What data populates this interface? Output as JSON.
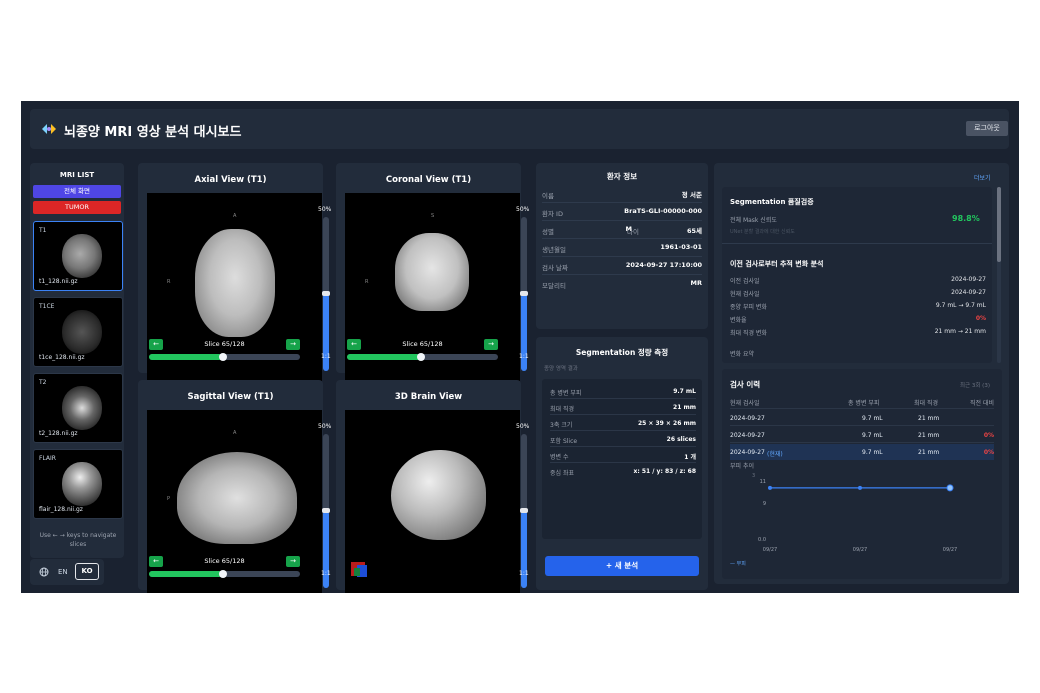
{
  "header": {
    "title": "뇌종양 MRI 영상 분석 대시보드",
    "logout": "로그아웃"
  },
  "sidebar": {
    "title": "MRI LIST",
    "full_view": "전체 화면",
    "tumor": "TUMOR",
    "items": [
      {
        "tag": "T1",
        "file": "t1_128.nii.gz"
      },
      {
        "tag": "T1CE",
        "file": "t1ce_128.nii.gz"
      },
      {
        "tag": "T2",
        "file": "t2_128.nii.gz"
      },
      {
        "tag": "FLAIR",
        "file": "flair_128.nii.gz"
      }
    ],
    "hint": "Use ← → keys to navigate slices"
  },
  "lang": {
    "en": "EN",
    "ko": "KO"
  },
  "views": {
    "axial": {
      "title": "Axial View (T1)",
      "slice": "Slice 65/128",
      "pct": "50%",
      "scale": "1:1"
    },
    "coronal": {
      "title": "Coronal View (T1)",
      "slice": "Slice 65/128",
      "pct": "50%",
      "scale": "1:1"
    },
    "sagittal": {
      "title": "Sagittal View (T1)",
      "slice": "Slice 65/128",
      "pct": "50%",
      "scale": "1:1"
    },
    "brain3d": {
      "title": "3D Brain View",
      "pct": "50%",
      "scale": "1:1"
    },
    "zoom_fraction": 0.5,
    "slice_fraction": 0.508
  },
  "patient": {
    "title": "환자 정보",
    "rows": [
      {
        "k": "이름",
        "v": "정 서준"
      },
      {
        "k": "환자 ID",
        "v": "BraTS-GLI-00000-000"
      },
      {
        "k": "성별",
        "v": "M"
      },
      {
        "k": "생년월일",
        "v": "1961-03-01"
      },
      {
        "k": "검사 날짜",
        "v": "2024-09-27 17:10:00"
      },
      {
        "k": "모달리티",
        "v": "MR"
      }
    ],
    "age_label": "나이",
    "age": "65세"
  },
  "measure": {
    "title": "Segmentation 정량 측정",
    "subtitle": "종양 영역 결과",
    "rows": [
      {
        "k": "총 병변 부피",
        "v": "9.7 mL"
      },
      {
        "k": "최대 직경",
        "v": "21 mm"
      },
      {
        "k": "3축 크기",
        "v": "25 × 39 × 26 mm"
      },
      {
        "k": "포함 Slice",
        "v": "26 slices"
      },
      {
        "k": "병변 수",
        "v": "1 개"
      },
      {
        "k": "중심 좌표",
        "v": "x: 51 / y: 83 / z: 68"
      }
    ],
    "new_btn": "+ 새 분석"
  },
  "analysis": {
    "more": "더보기",
    "qc_title": "Segmentation 품질검증",
    "qc_label": "전체 Mask 신뢰도",
    "qc_value": "98.8%",
    "qc_sub": "UNet 분할 결과에 대한 신뢰도",
    "trend_title": "이전 검사로부터 추적 변화 분석",
    "trend_rows": [
      {
        "k": "이전 검사일",
        "v": "2024-09-27"
      },
      {
        "k": "현재 검사일",
        "v": "2024-09-27"
      },
      {
        "k": "종양 부피 변화",
        "v": "9.7 mL → 9.7 mL"
      },
      {
        "k": "변화율",
        "v": "0%"
      },
      {
        "k": "최대 직경 변화",
        "v": "21 mm → 21 mm"
      }
    ],
    "summary": "변화 요약",
    "history_title": "검사 이력",
    "history_sub": "최근 3회 (3)",
    "history_cols": [
      "현재 검사일",
      "총 병변 부피",
      "최대 직경",
      "직전 대비"
    ],
    "history_rows": [
      {
        "date": "2024-09-27",
        "tag": "",
        "vol": "9.7 mL",
        "dia": "21 mm",
        "chg": ""
      },
      {
        "date": "2024-09-27",
        "tag": "",
        "vol": "9.7 mL",
        "dia": "21 mm",
        "chg": "0%"
      },
      {
        "date": "2024-09-27",
        "tag": "(현재)",
        "vol": "9.7 mL",
        "dia": "21 mm",
        "chg": "0%"
      }
    ],
    "chart_title": "부피 추이",
    "legend": "— 부피"
  },
  "chart_data": {
    "type": "line",
    "title": "부피 추이",
    "x": [
      "09/27",
      "09/27",
      "09/27"
    ],
    "series": [
      {
        "name": "부피",
        "values": [
          9.7,
          9.7,
          9.7
        ]
      }
    ],
    "ylim": [
      0,
      11
    ],
    "yticks": [
      "11",
      "9",
      "0.0"
    ],
    "y_unit": "3",
    "legend": "bottom-left",
    "grid": false
  },
  "colors": {
    "bg": "#1a2230",
    "panel": "#222c3b",
    "blue": "#3b82f6",
    "green": "#22c55e",
    "red": "#ef4444",
    "purple": "#4f46e5"
  }
}
